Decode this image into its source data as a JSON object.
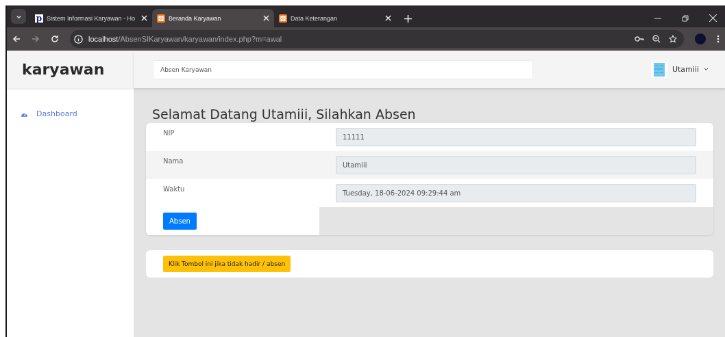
{
  "browser": {
    "tabs": [
      {
        "title": "Sistem Informasi Karyawan - Ho",
        "selected": false,
        "kind": "letter",
        "favicon_text": "p"
      },
      {
        "title": "Beranda Karyawan",
        "selected": true,
        "kind": "xampp"
      },
      {
        "title": "Data Keterangan",
        "selected": false,
        "kind": "xampp"
      }
    ],
    "url_host": "localhost",
    "url_path": "/AbsenSIKaryawan/karyawan/index.php?m=awal"
  },
  "sidebar": {
    "brand": "karyawan",
    "items": [
      {
        "label": "Dashboard"
      }
    ]
  },
  "header": {
    "page_label": "Absen Karyawan",
    "user_name": "Utamiii"
  },
  "content": {
    "title": "Selamat Datang Utamiii, Silahkan Absen",
    "fields": [
      {
        "label": "NIP",
        "value": "11111"
      },
      {
        "label": "Nama",
        "value": "Utamiii"
      },
      {
        "label": "Waktu",
        "value": "Tuesday, 18-06-2024 09:29:44 am"
      }
    ],
    "submit_button": "Absen",
    "absent_button": "Klik Tombol ini jika tidak hadir / absen"
  }
}
